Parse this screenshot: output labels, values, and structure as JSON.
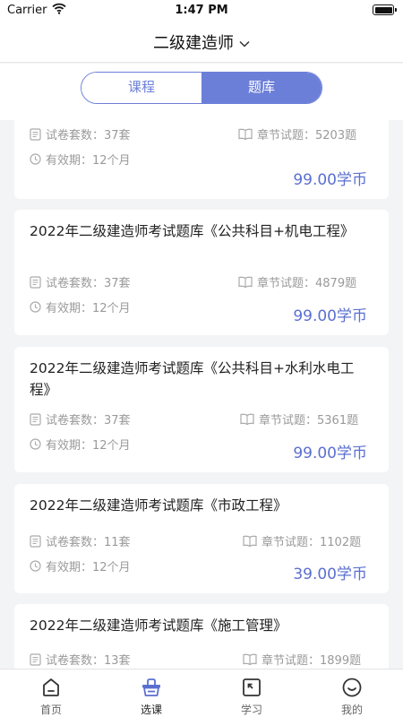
{
  "status_bar": {
    "carrier": "Carrier",
    "time": "1:47 PM"
  },
  "nav": {
    "title": "二级建造师"
  },
  "segment": {
    "tabs": [
      {
        "label": "课程",
        "active": false
      },
      {
        "label": "题库",
        "active": true
      }
    ]
  },
  "colors": {
    "accent": "#6c7fd8",
    "price": "#5b6fd0"
  },
  "cards": [
    {
      "title": "",
      "papers": "试卷套数：37套",
      "chapters": "章节试题：5203题",
      "validity": "有效期：12个月",
      "price": "99.00学币"
    },
    {
      "title": "2022年二级建造师考试题库《公共科目+机电工程》",
      "papers": "试卷套数：37套",
      "chapters": "章节试题：4879题",
      "validity": "有效期：12个月",
      "price": "99.00学币"
    },
    {
      "title": "2022年二级建造师考试题库《公共科目+水利水电工程》",
      "papers": "试卷套数：37套",
      "chapters": "章节试题：5361题",
      "validity": "有效期：12个月",
      "price": "99.00学币"
    },
    {
      "title": "2022年二级建造师考试题库《市政工程》",
      "papers": "试卷套数：11套",
      "chapters": "章节试题：1102题",
      "validity": "有效期：12个月",
      "price": "39.00学币"
    },
    {
      "title": "2022年二级建造师考试题库《施工管理》",
      "papers": "试卷套数：13套",
      "chapters": "章节试题：1899题",
      "validity": "",
      "price": ""
    }
  ],
  "tab_bar": {
    "items": [
      {
        "label": "首页",
        "icon": "home-icon",
        "active": false
      },
      {
        "label": "选课",
        "icon": "basket-icon",
        "active": true
      },
      {
        "label": "学习",
        "icon": "study-icon",
        "active": false
      },
      {
        "label": "我的",
        "icon": "profile-icon",
        "active": false
      }
    ]
  }
}
